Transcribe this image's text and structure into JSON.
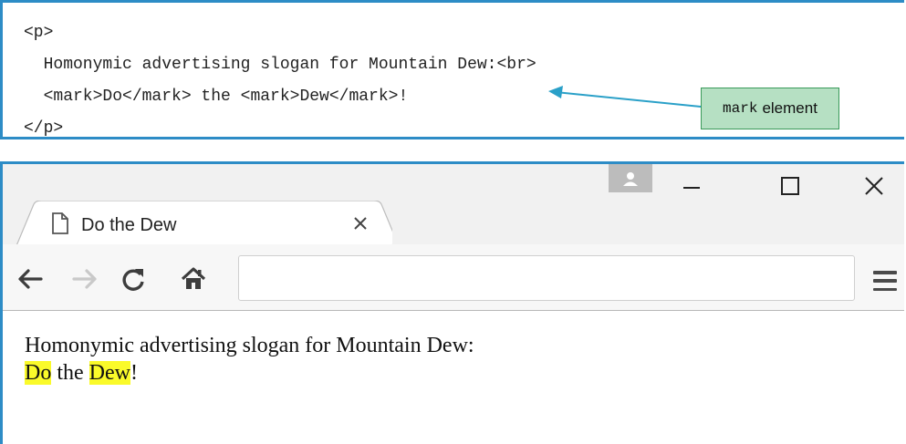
{
  "code": {
    "lines": [
      "<p>",
      "  Homonymic advertising slogan for Mountain Dew:<br>",
      "  <mark>Do</mark> the <mark>Dew</mark>!",
      "</p>"
    ]
  },
  "callout": {
    "code_word": "mark",
    "text": "element"
  },
  "browser": {
    "tab_title": "Do the Dew",
    "address_value": "",
    "page": {
      "line1": "Homonymic advertising slogan for Mountain Dew:",
      "line2": {
        "mark1": "Do",
        "middle": " the ",
        "mark2": "Dew",
        "end": "!"
      }
    }
  },
  "icons": {
    "page": "page-icon",
    "tab_close": "close-icon",
    "profile": "person-icon",
    "minimize": "minimize-icon",
    "maximize": "maximize-icon",
    "close": "close-icon",
    "back": "arrow-left-icon",
    "forward": "arrow-right-icon",
    "reload": "reload-icon",
    "home": "home-icon",
    "menu": "hamburger-menu-icon"
  },
  "colors": {
    "panel_border": "#2d8cc6",
    "callout_fill": "#b6e0c3",
    "callout_border": "#3a9a5a",
    "arrow": "#2aa0c8",
    "highlight": "#fafa2a"
  }
}
